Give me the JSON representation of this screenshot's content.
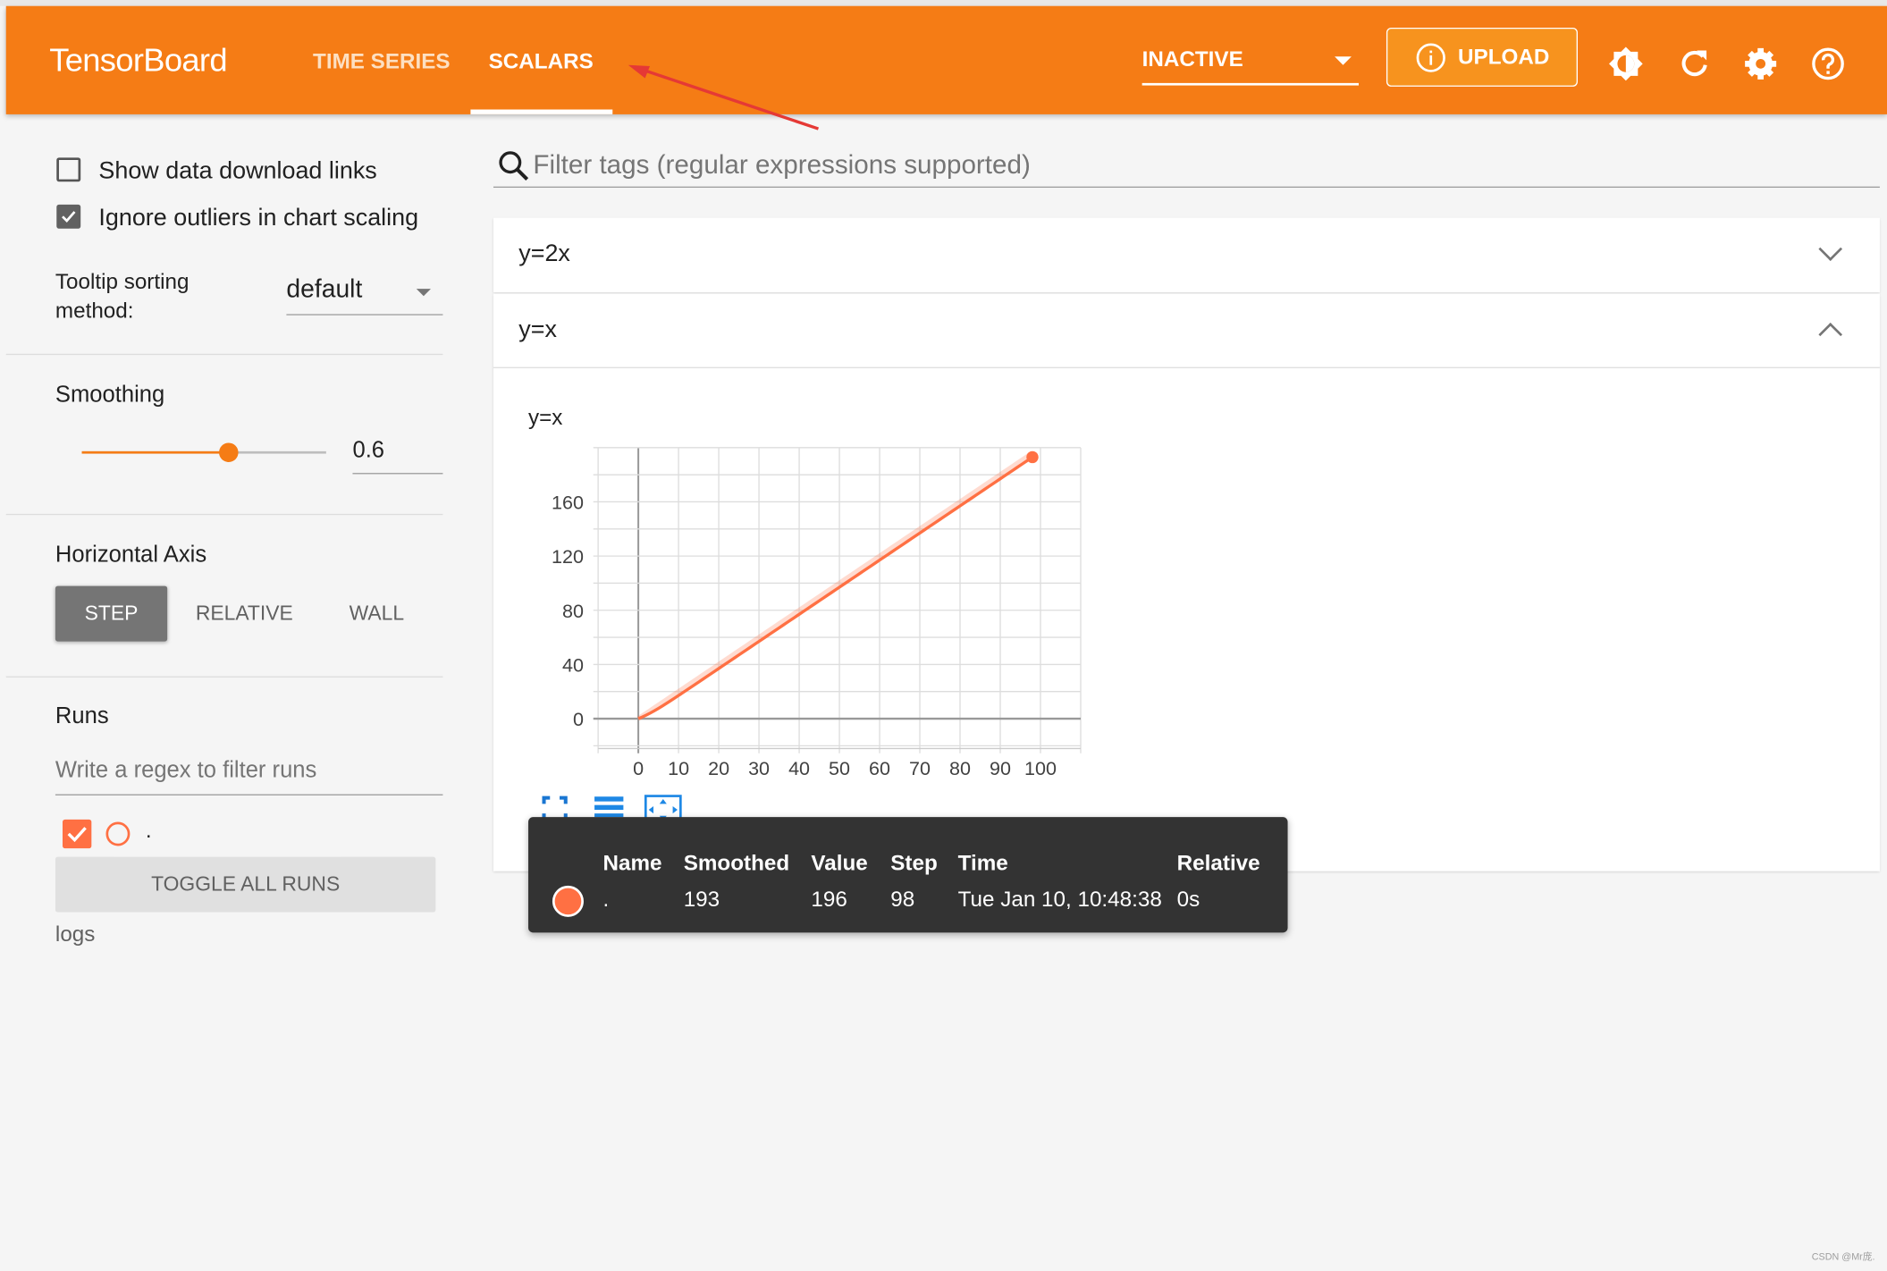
{
  "header": {
    "logo": "TensorBoard",
    "tabs": [
      {
        "label": "TIME SERIES",
        "active": false
      },
      {
        "label": "SCALARS",
        "active": true
      }
    ],
    "status_select": "INACTIVE",
    "upload_label": "UPLOAD",
    "icons": [
      "info-icon",
      "theme-brightness-icon",
      "refresh-icon",
      "settings-gear-icon",
      "help-icon"
    ],
    "accent_color": "#f57c15"
  },
  "sidebar": {
    "show_download_links": {
      "label": "Show data download links",
      "checked": false
    },
    "ignore_outliers": {
      "label": "Ignore outliers in chart scaling",
      "checked": true
    },
    "tooltip_sorting": {
      "label_line1": "Tooltip sorting",
      "label_line2": "method:",
      "value": "default"
    },
    "smoothing": {
      "label": "Smoothing",
      "value": 0.6,
      "value_text": "0.6"
    },
    "horizontal_axis": {
      "label": "Horizontal Axis",
      "options": [
        "STEP",
        "RELATIVE",
        "WALL"
      ],
      "selected": "STEP"
    },
    "runs": {
      "label": "Runs",
      "filter_placeholder": "Write a regex to filter runs",
      "items": [
        {
          "name": ".",
          "checked": true,
          "color": "#ff7043"
        }
      ],
      "toggle_all_label": "TOGGLE ALL RUNS",
      "logdir": "logs"
    }
  },
  "main": {
    "filter_placeholder": "Filter tags (regular expressions supported)",
    "cards": [
      {
        "title": "y=2x",
        "expanded": false
      },
      {
        "title": "y=x",
        "expanded": true
      }
    ]
  },
  "chart_data": {
    "type": "line",
    "title": "y=x",
    "xlim": [
      -10,
      110
    ],
    "ylim": [
      -22,
      200
    ],
    "xticks": [
      0,
      10,
      20,
      30,
      40,
      50,
      60,
      70,
      80,
      90,
      100
    ],
    "yticks": [
      0,
      40,
      80,
      120,
      160
    ],
    "grid": true,
    "smoothing": 0.6,
    "series": [
      {
        "color": "#ff7043",
        "x": [
          0,
          1,
          2,
          3,
          4,
          5,
          6,
          7,
          8,
          9,
          10,
          11,
          12,
          13,
          14,
          15,
          16,
          17,
          18,
          19,
          20,
          21,
          22,
          23,
          24,
          25,
          26,
          27,
          28,
          29,
          30,
          31,
          32,
          33,
          34,
          35,
          36,
          37,
          38,
          39,
          40,
          41,
          42,
          43,
          44,
          45,
          46,
          47,
          48,
          49,
          50,
          51,
          52,
          53,
          54,
          55,
          56,
          57,
          58,
          59,
          60,
          61,
          62,
          63,
          64,
          65,
          66,
          67,
          68,
          69,
          70,
          71,
          72,
          73,
          74,
          75,
          76,
          77,
          78,
          79,
          80,
          81,
          82,
          83,
          84,
          85,
          86,
          87,
          88,
          89,
          90,
          91,
          92,
          93,
          94,
          95,
          96,
          97,
          98
        ],
        "y": [
          0,
          2,
          4,
          6,
          8,
          10,
          12,
          14,
          16,
          18,
          20,
          22,
          24,
          26,
          28,
          30,
          32,
          34,
          36,
          38,
          40,
          42,
          44,
          46,
          48,
          50,
          52,
          54,
          56,
          58,
          60,
          62,
          64,
          66,
          68,
          70,
          72,
          74,
          76,
          78,
          80,
          82,
          84,
          86,
          88,
          90,
          92,
          94,
          96,
          98,
          100,
          102,
          104,
          106,
          108,
          110,
          112,
          114,
          116,
          118,
          120,
          122,
          124,
          126,
          128,
          130,
          132,
          134,
          136,
          138,
          140,
          142,
          144,
          146,
          148,
          150,
          152,
          154,
          156,
          158,
          160,
          162,
          164,
          166,
          168,
          170,
          172,
          174,
          176,
          178,
          180,
          182,
          184,
          186,
          188,
          190,
          192,
          194,
          196
        ]
      }
    ]
  },
  "tooltip": {
    "headers": [
      "Name",
      "Smoothed",
      "Value",
      "Step",
      "Time",
      "Relative"
    ],
    "row": {
      "name": ".",
      "smoothed": "193",
      "value": "196",
      "step": "98",
      "time": "Tue Jan 10, 10:48:38",
      "relative": "0s",
      "color": "#ff7043"
    }
  },
  "chart_toolbar_icons": [
    "fit-domain-icon",
    "toggle-log-scale-icon",
    "expand-chart-icon"
  ],
  "watermark": "CSDN @Mr庞."
}
